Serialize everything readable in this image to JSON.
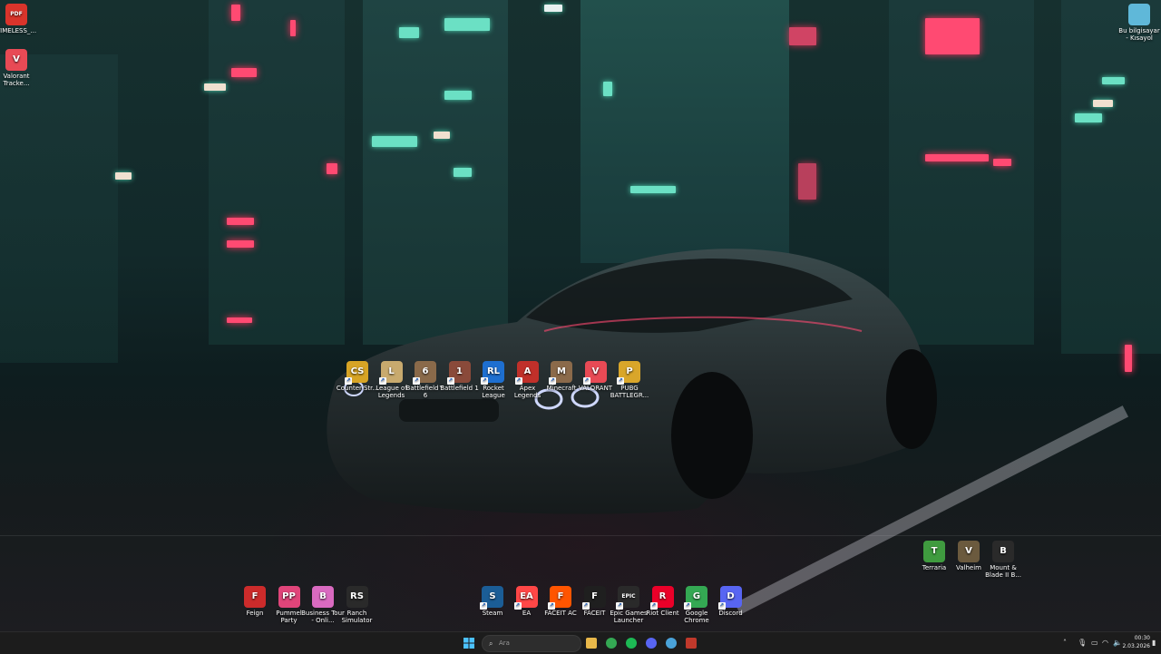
{
  "desktop": {
    "top_left_icons": [
      {
        "label": "TIMELESS_...",
        "icon": "pdf-file-icon",
        "color": "#d9342b",
        "glyph": "PDF"
      },
      {
        "label": "Valorant Tracke...",
        "icon": "valorant-tracker-icon",
        "color": "#e84a55",
        "glyph": "V"
      }
    ],
    "top_right_icons": [
      {
        "label": "Bu bilgisayar - Kısayol",
        "icon": "this-pc-shortcut-icon",
        "color": "#5fb8d9"
      }
    ],
    "center_icons": [
      {
        "label": "Counter-Str...",
        "icon": "counter-strike-icon",
        "color": "#d7a425",
        "glyph": "CS"
      },
      {
        "label": "League of Legends",
        "icon": "league-of-legends-icon",
        "color": "#c8aa6e",
        "glyph": "L"
      },
      {
        "label": "Battlefield™ 6",
        "icon": "battlefield-6-icon",
        "color": "#8a6a4a",
        "glyph": "6"
      },
      {
        "label": "Battlefield 1",
        "icon": "battlefield-1-icon",
        "color": "#8a4a3a",
        "glyph": "1"
      },
      {
        "label": "Rocket League",
        "icon": "rocket-league-icon",
        "color": "#1e6fd0",
        "glyph": "RL"
      },
      {
        "label": "Apex Legends",
        "icon": "apex-legends-icon",
        "color": "#c0302a",
        "glyph": "A"
      },
      {
        "label": "Minecraft",
        "icon": "minecraft-icon",
        "color": "#8b6a4a",
        "glyph": "M"
      },
      {
        "label": "VALORANT",
        "icon": "valorant-icon",
        "color": "#e84a55",
        "glyph": "V"
      },
      {
        "label": "PUBG BATTLEGR...",
        "icon": "pubg-icon",
        "color": "#d9a62a",
        "glyph": "P"
      }
    ],
    "bottom_left_icons": [
      {
        "label": "Feign",
        "icon": "feign-icon",
        "color": "#cc2b2b",
        "glyph": "F"
      },
      {
        "label": "Pummel Party",
        "icon": "pummel-party-icon",
        "color": "#e0457a",
        "glyph": "PP"
      },
      {
        "label": "Business Tour - Onli...",
        "icon": "business-tour-icon",
        "color": "#d96ac0",
        "glyph": "B"
      },
      {
        "label": "Ranch Simulator",
        "icon": "ranch-simulator-icon",
        "color": "#2a2a2a",
        "glyph": "RS"
      }
    ],
    "bottom_center_icons": [
      {
        "label": "Steam",
        "icon": "steam-icon",
        "color": "#1b5d96",
        "glyph": "S"
      },
      {
        "label": "EA",
        "icon": "ea-icon",
        "color": "#ff4747",
        "glyph": "EA"
      },
      {
        "label": "FACEIT AC",
        "icon": "faceit-ac-icon",
        "color": "#ff5500",
        "glyph": "F"
      },
      {
        "label": "FACEIT",
        "icon": "faceit-icon",
        "color": "#1f1f1f",
        "glyph": "F"
      },
      {
        "label": "Epic Games Launcher",
        "icon": "epic-games-icon",
        "color": "#2a2a2a",
        "glyph": "EPIC"
      },
      {
        "label": "Riot Client",
        "icon": "riot-client-icon",
        "color": "#eb0029",
        "glyph": "R"
      },
      {
        "label": "Google Chrome",
        "icon": "chrome-icon",
        "color": "#34a853",
        "glyph": "G"
      },
      {
        "label": "Discord",
        "icon": "discord-icon",
        "color": "#5865f2",
        "glyph": "D"
      }
    ],
    "bottom_right_icons": [
      {
        "label": "Terraria",
        "icon": "terraria-icon",
        "color": "#3f9b3f",
        "glyph": "T"
      },
      {
        "label": "Valheim",
        "icon": "valheim-icon",
        "color": "#6b5a3e",
        "glyph": "V"
      },
      {
        "label": "Mount & Blade II B...",
        "icon": "mount-blade-icon",
        "color": "#2a2a2a",
        "glyph": "B"
      }
    ]
  },
  "taskbar": {
    "search_placeholder": "Ara",
    "pinned": [
      {
        "name": "file-explorer-icon",
        "color": "#e8b84a"
      },
      {
        "name": "chrome-icon",
        "color": "#34a853"
      },
      {
        "name": "spotify-icon",
        "color": "#1db954"
      },
      {
        "name": "discord-icon",
        "color": "#5865f2"
      },
      {
        "name": "steam-icon",
        "color": "#4aa3d9"
      },
      {
        "name": "recording-app-icon",
        "color": "#c0392b"
      }
    ],
    "clock_time": "00:30",
    "clock_date": "2.03.2026"
  }
}
